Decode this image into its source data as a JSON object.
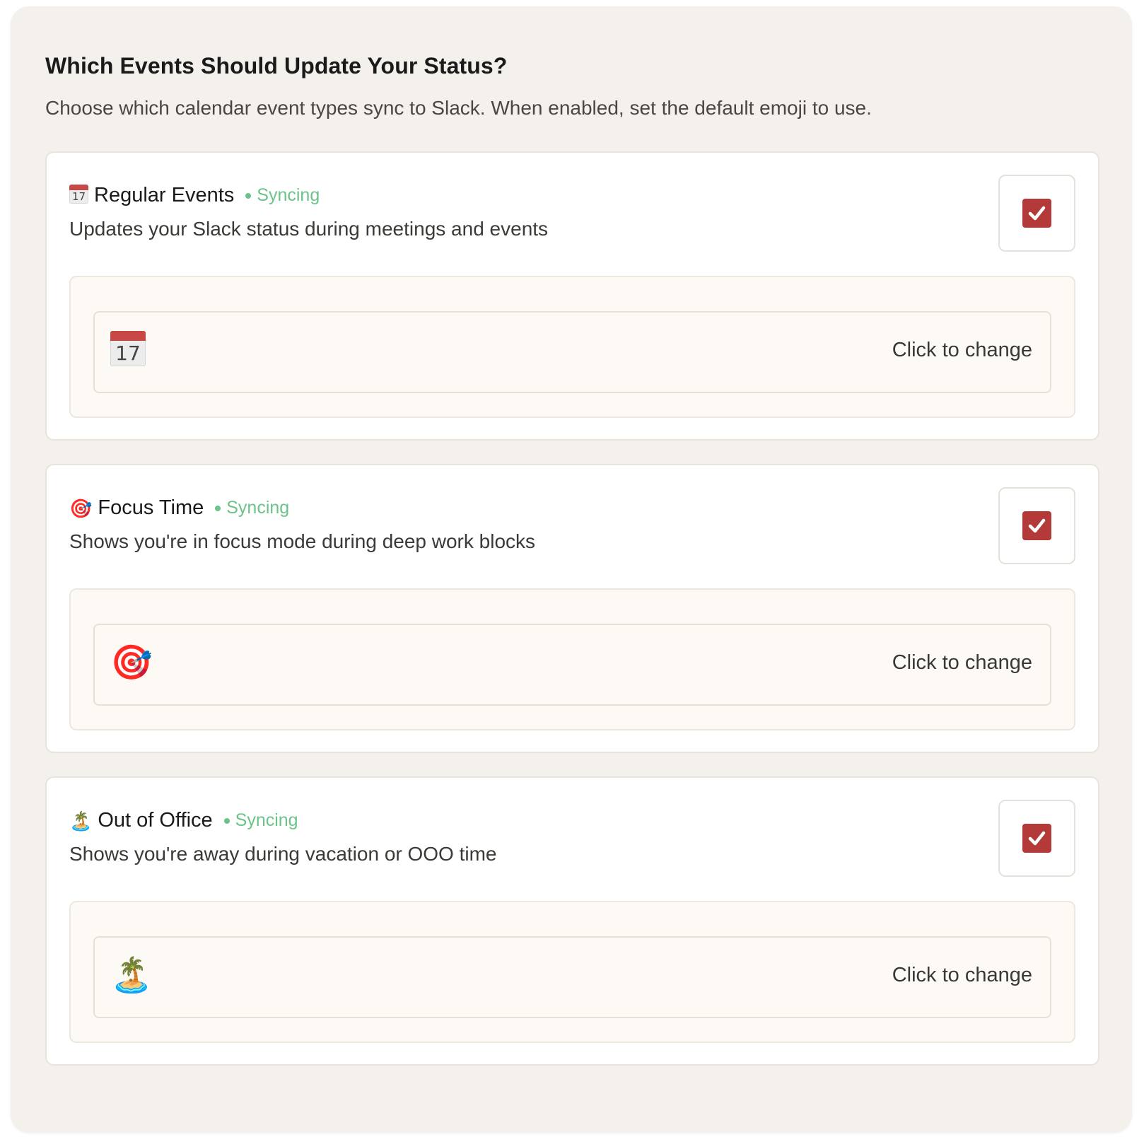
{
  "header": {
    "title": "Which Events Should Update Your Status?",
    "description": "Choose which calendar event types sync to Slack. When enabled, set the default emoji to use."
  },
  "colors": {
    "panel_background": "#f4f1ec",
    "syncing_green": "#6cc389",
    "checkbox_red": "#b33a38"
  },
  "event_types": [
    {
      "icon": "calendar-icon",
      "calendar_day": "17",
      "title": "Regular Events",
      "status": "Syncing",
      "description": "Updates your Slack status during meetings and events",
      "enabled": true,
      "emoji_hint": "Click to change"
    },
    {
      "icon": "target-icon",
      "emoji": "🎯",
      "title": "Focus Time",
      "status": "Syncing",
      "description": "Shows you're in focus mode during deep work blocks",
      "enabled": true,
      "emoji_hint": "Click to change"
    },
    {
      "icon": "island-icon",
      "emoji": "🏝️",
      "title": "Out of Office",
      "status": "Syncing",
      "description": "Shows you're away during vacation or OOO time",
      "enabled": true,
      "emoji_hint": "Click to change"
    }
  ]
}
